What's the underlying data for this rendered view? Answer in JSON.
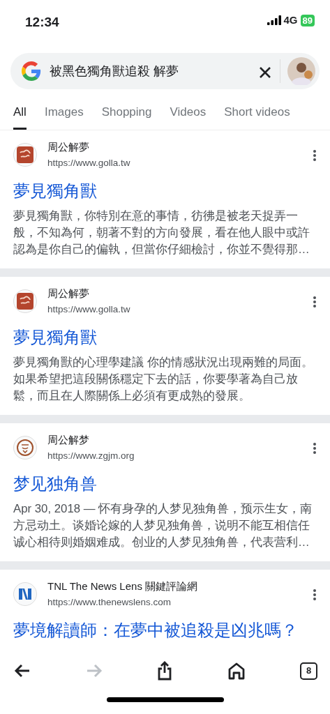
{
  "status_bar": {
    "time": "12:34",
    "network": "4G",
    "battery": "89"
  },
  "search": {
    "query": "被黑色獨角獸追殺 解夢"
  },
  "tabs": [
    {
      "label": "All",
      "selected": true
    },
    {
      "label": "Images",
      "selected": false
    },
    {
      "label": "Shopping",
      "selected": false
    },
    {
      "label": "Videos",
      "selected": false
    },
    {
      "label": "Short videos",
      "selected": false
    }
  ],
  "results": [
    {
      "kind": "seal",
      "site": "周公解夢",
      "url": "https://www.golla.tw",
      "title": "夢見獨角獸",
      "snippet": "夢見獨角獸，你特別在意的事情，彷彿是被老天捉弄一般，不知為何，朝著不對的方向發展，看在他人眼中或許認為是你自己的偏執，但當你仔細檢討，你並不覺得那…"
    },
    {
      "kind": "seal",
      "site": "周公解夢",
      "url": "https://www.golla.tw",
      "title": "夢見獨角獸",
      "snippet": "夢見獨角獸的心理學建議 你的情感狀況出現兩難的局面。如果希望把這段關係穩定下去的話，你要學著為自己放鬆，而且在人際關係上必須有更成熟的發展。"
    },
    {
      "kind": "ring",
      "site": "周公解梦",
      "url": "https://www.zgjm.org",
      "title": "梦见独角兽",
      "snippet": "Apr 30, 2018 — 怀有身孕的人梦见独角兽，预示生女，南方忌动土。谈婚论嫁的人梦见独角兽，说明不能互相信任诚心相待则婚姻难成。创业的人梦见独角兽，代表营利…"
    },
    {
      "kind": "news",
      "site": "TNL The News Lens 關鍵評論網",
      "url": "https://www.thenewslens.com",
      "title": "夢境解讀師：在夢中被追殺是凶兆嗎？"
    }
  ],
  "toolbar": [
    {
      "kind": "back",
      "disabled": false
    },
    {
      "kind": "forward",
      "disabled": true
    },
    {
      "kind": "share",
      "disabled": false
    },
    {
      "kind": "home",
      "disabled": false
    },
    {
      "kind": "tabs",
      "disabled": false,
      "count": "8"
    }
  ]
}
